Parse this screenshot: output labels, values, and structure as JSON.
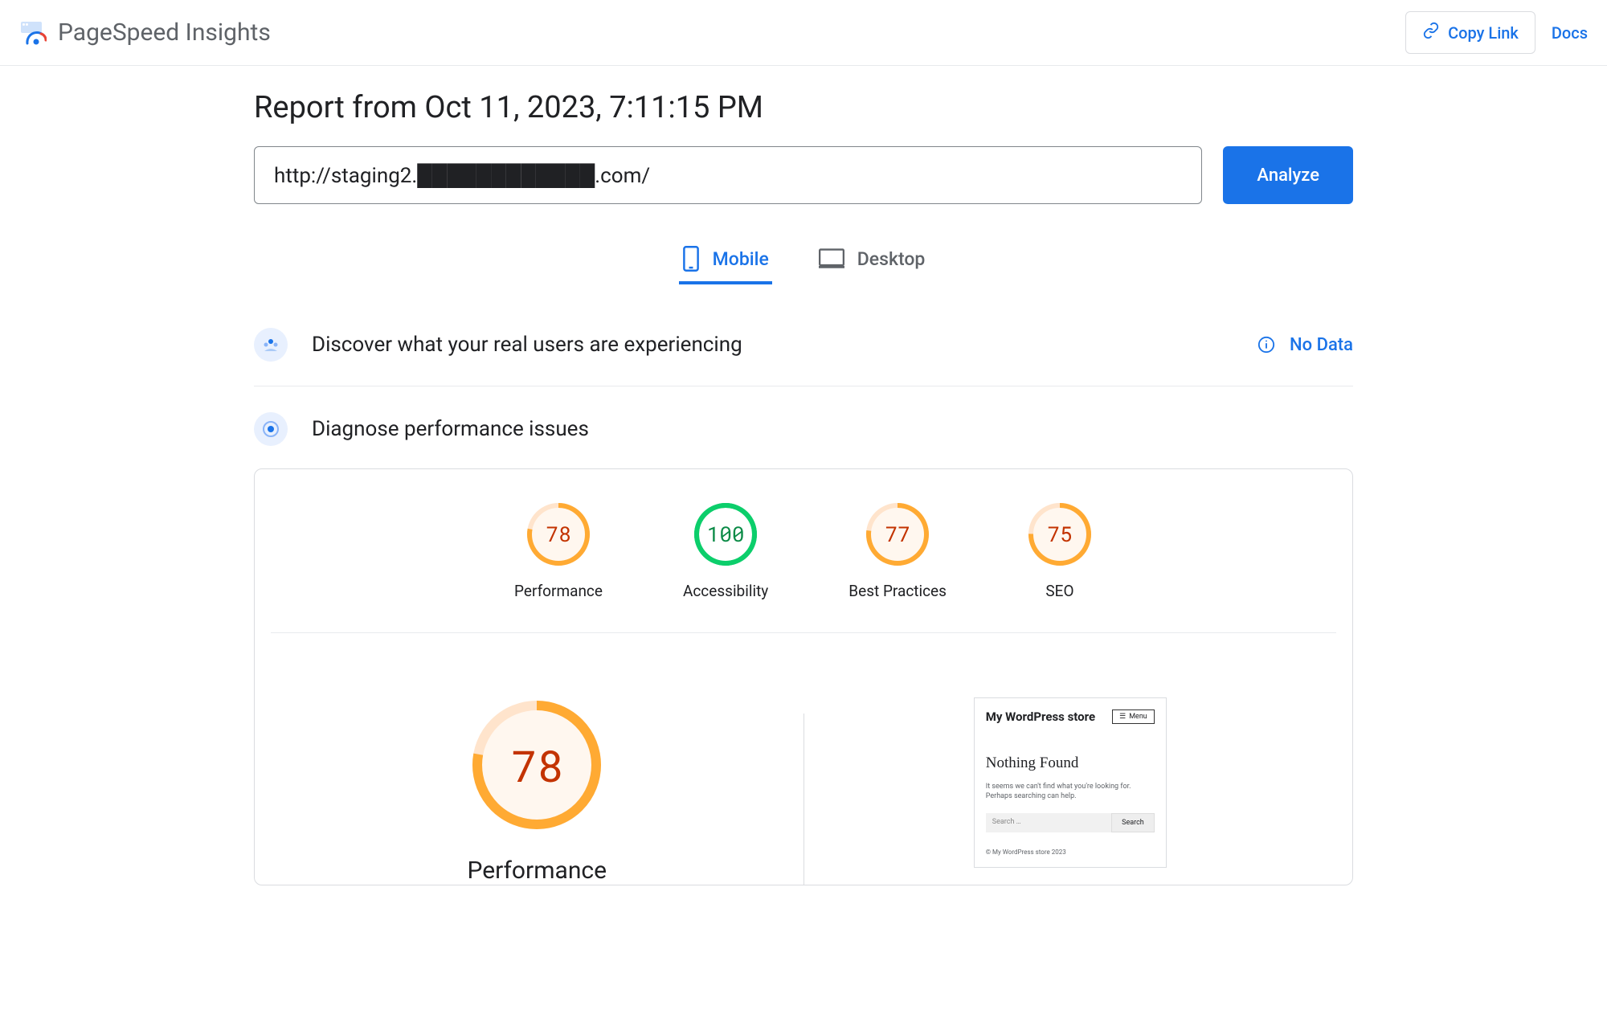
{
  "header": {
    "app_title": "PageSpeed Insights",
    "copy_link": "Copy Link",
    "docs": "Docs"
  },
  "report": {
    "title": "Report from Oct 11, 2023, 7:11:15 PM",
    "url_value": "http://staging2.████████████.com/",
    "analyze_label": "Analyze"
  },
  "tabs": {
    "mobile": "Mobile",
    "desktop": "Desktop"
  },
  "sections": {
    "crux_title": "Discover what your real users are experiencing",
    "no_data": "No Data",
    "diagnose_title": "Diagnose performance issues"
  },
  "gauges": [
    {
      "score": 78,
      "label": "Performance",
      "color": "orange"
    },
    {
      "score": 100,
      "label": "Accessibility",
      "color": "green"
    },
    {
      "score": 77,
      "label": "Best Practices",
      "color": "orange"
    },
    {
      "score": 75,
      "label": "SEO",
      "color": "orange"
    }
  ],
  "perf_detail": {
    "score": 78,
    "label": "Performance"
  },
  "preview": {
    "site_title": "My WordPress store",
    "menu_label": "Menu",
    "heading": "Nothing Found",
    "text": "It seems we can't find what you're looking for. Perhaps searching can help.",
    "search_placeholder": "Search …",
    "search_btn": "Search",
    "footer": "© My WordPress store 2023"
  },
  "chart_data": {
    "type": "gauge",
    "title": "PageSpeed Insights Category Scores",
    "series": [
      {
        "name": "Performance",
        "value": 78,
        "range": [
          0,
          100
        ]
      },
      {
        "name": "Accessibility",
        "value": 100,
        "range": [
          0,
          100
        ]
      },
      {
        "name": "Best Practices",
        "value": 77,
        "range": [
          0,
          100
        ]
      },
      {
        "name": "SEO",
        "value": 75,
        "range": [
          0,
          100
        ]
      }
    ]
  }
}
